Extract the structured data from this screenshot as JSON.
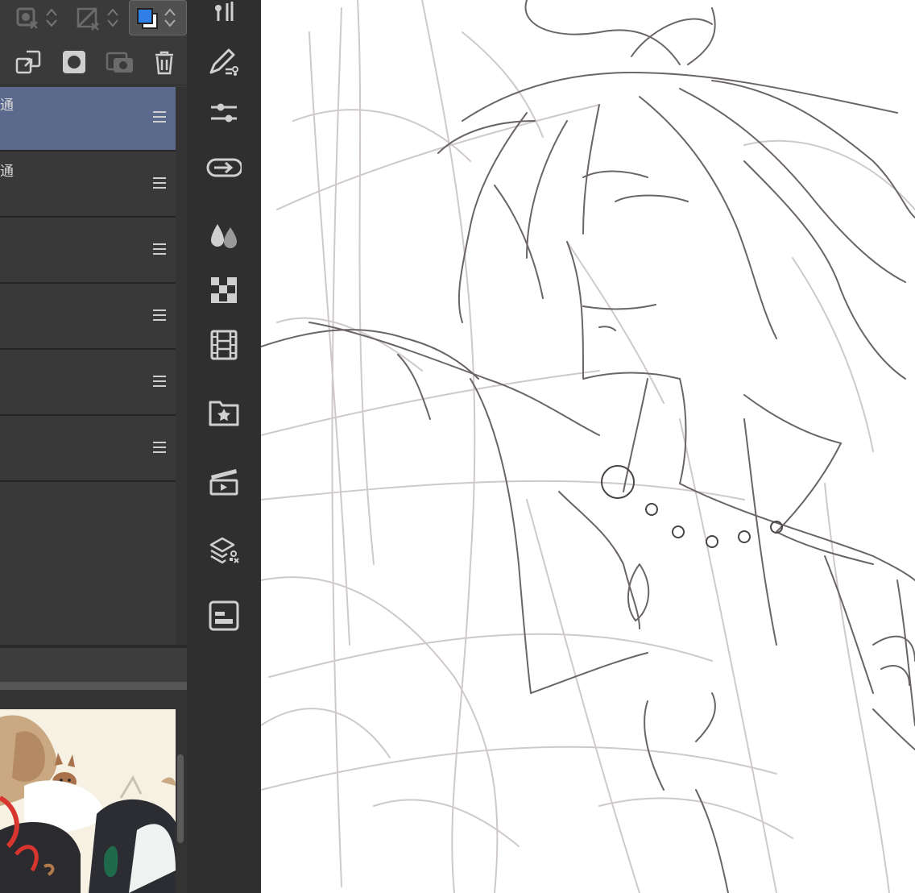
{
  "toolbar": {
    "items": [
      {
        "icon": "lock-transparency-icon",
        "active": false
      },
      {
        "icon": "clip-lower-layer-icon",
        "active": false
      },
      {
        "icon": "color-swatch-icon",
        "active": true
      }
    ]
  },
  "layer_actions": [
    {
      "icon": "copy-layer-icon"
    },
    {
      "icon": "layer-mask-icon"
    },
    {
      "icon": "merge-camera-icon"
    },
    {
      "icon": "trash-icon"
    }
  ],
  "layers": [
    {
      "label": "通",
      "selected": true
    },
    {
      "label": "通",
      "selected": false
    },
    {
      "label": "",
      "selected": false
    },
    {
      "label": "",
      "selected": false
    },
    {
      "label": "",
      "selected": false
    },
    {
      "label": "",
      "selected": false
    }
  ],
  "side_icons": [
    "brush-size-icon",
    "pen-layer-property-icon",
    "tool-settings-sliders-icon",
    "transform-icon",
    "color-drops-icon",
    "material-tiles-icon",
    "timeline-film-icon",
    "folder-star-icon",
    "animation-clapper-icon",
    "layer-effects-icon",
    "panel-layout-icon"
  ],
  "colors": {
    "panel_bg": "#3a3a3a",
    "selected_layer": "#5b6a8c",
    "icon_bar": "#2f2f2f",
    "canvas": "#ffffff",
    "main_color": "#2f7fe6"
  }
}
